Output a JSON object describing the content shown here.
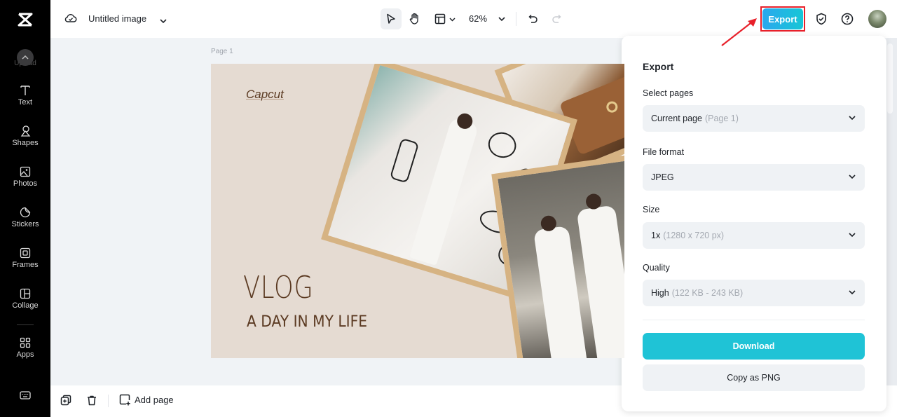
{
  "app": {
    "logo": "capcut-logo",
    "document_title": "Untitled image"
  },
  "sidebar": {
    "upload_label": "Upload",
    "items": [
      {
        "id": "text",
        "label": "Text",
        "icon": "text-icon"
      },
      {
        "id": "shapes",
        "label": "Shapes",
        "icon": "shapes-icon"
      },
      {
        "id": "photos",
        "label": "Photos",
        "icon": "photos-icon"
      },
      {
        "id": "stickers",
        "label": "Stickers",
        "icon": "stickers-icon"
      },
      {
        "id": "frames",
        "label": "Frames",
        "icon": "frames-icon"
      },
      {
        "id": "collage",
        "label": "Collage",
        "icon": "collage-icon"
      },
      {
        "id": "apps",
        "label": "Apps",
        "icon": "apps-icon"
      }
    ],
    "bottom_icon": "keyboard-icon"
  },
  "toolbar": {
    "zoom_level": "62%",
    "export_label": "Export"
  },
  "canvas": {
    "page_label": "Page 1",
    "design": {
      "brand": "Capcut",
      "title": "VLOG",
      "subtitle": "A DAY IN MY LIFE"
    }
  },
  "bottombar": {
    "add_page_label": "Add page"
  },
  "export_panel": {
    "title": "Export",
    "fields": [
      {
        "label": "Select pages",
        "value": "Current page",
        "hint": "(Page 1)"
      },
      {
        "label": "File format",
        "value": "JPEG",
        "hint": ""
      },
      {
        "label": "Size",
        "value": "1x",
        "hint": "(1280 x 720 px)"
      },
      {
        "label": "Quality",
        "value": "High",
        "hint": "(122 KB - 243 KB)"
      }
    ],
    "download_label": "Download",
    "copy_label": "Copy as PNG"
  },
  "colors": {
    "accent": "#1fc3d6",
    "highlight": "#e8202a",
    "sidebar_bg": "#000000",
    "artboard_bg": "#e5dbd2",
    "design_text": "#5b3a22",
    "frame": "#d6b383"
  }
}
